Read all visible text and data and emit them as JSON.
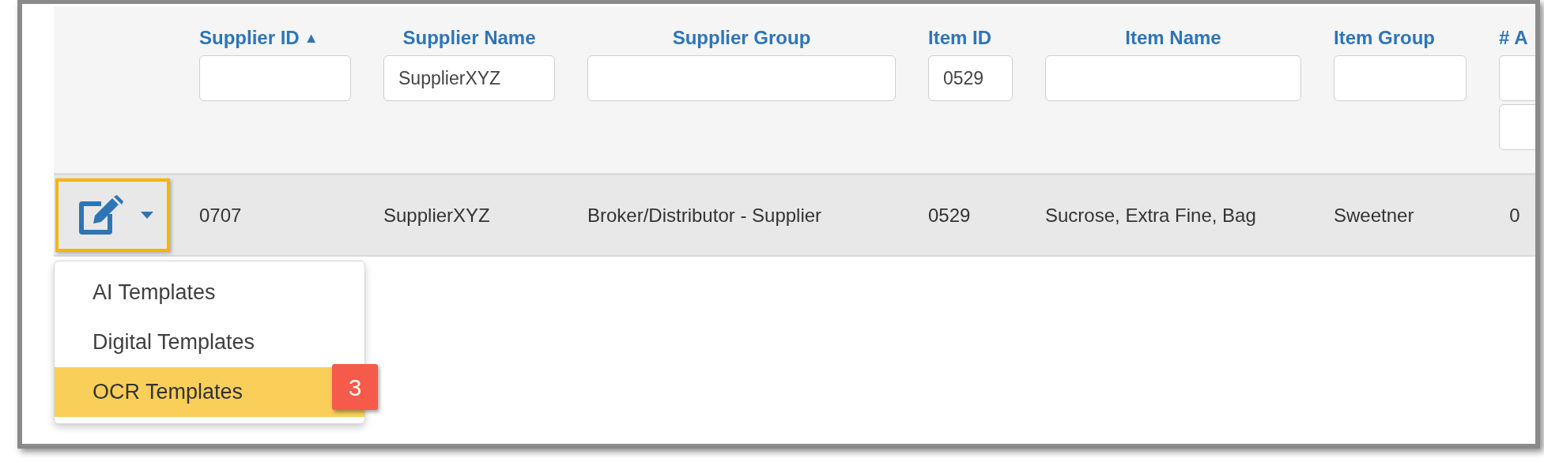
{
  "table": {
    "columns": [
      {
        "label": "Supplier ID",
        "sort_indicator": "▲",
        "filters": [
          {
            "kind": "text"
          }
        ]
      },
      {
        "label": "Supplier Name",
        "filters": [
          {
            "kind": "text",
            "value": "SupplierXYZ"
          }
        ]
      },
      {
        "label": "Supplier Group",
        "filters": [
          {
            "kind": "text"
          }
        ]
      },
      {
        "label": "Item ID",
        "filters": [
          {
            "kind": "text",
            "value": "0529"
          }
        ]
      },
      {
        "label": "Item Name",
        "filters": [
          {
            "kind": "text"
          }
        ]
      },
      {
        "label": "Item Group",
        "filters": [
          {
            "kind": "text"
          }
        ]
      },
      {
        "label": "# A",
        "filters": [
          {
            "kind": "text"
          },
          {
            "kind": "text"
          }
        ]
      }
    ],
    "rows": [
      {
        "cells": [
          "0707",
          "SupplierXYZ",
          "Broker/Distributor - Supplier",
          "0529",
          "Sucrose, Extra Fine, Bag",
          "Sweetner",
          "0"
        ],
        "highlighted": true
      }
    ]
  },
  "action_menu": {
    "items": [
      {
        "label": "AI Templates",
        "selected": false
      },
      {
        "label": "Digital Templates",
        "selected": false
      },
      {
        "label": "OCR Templates",
        "selected": true,
        "callout": "3"
      }
    ]
  }
}
